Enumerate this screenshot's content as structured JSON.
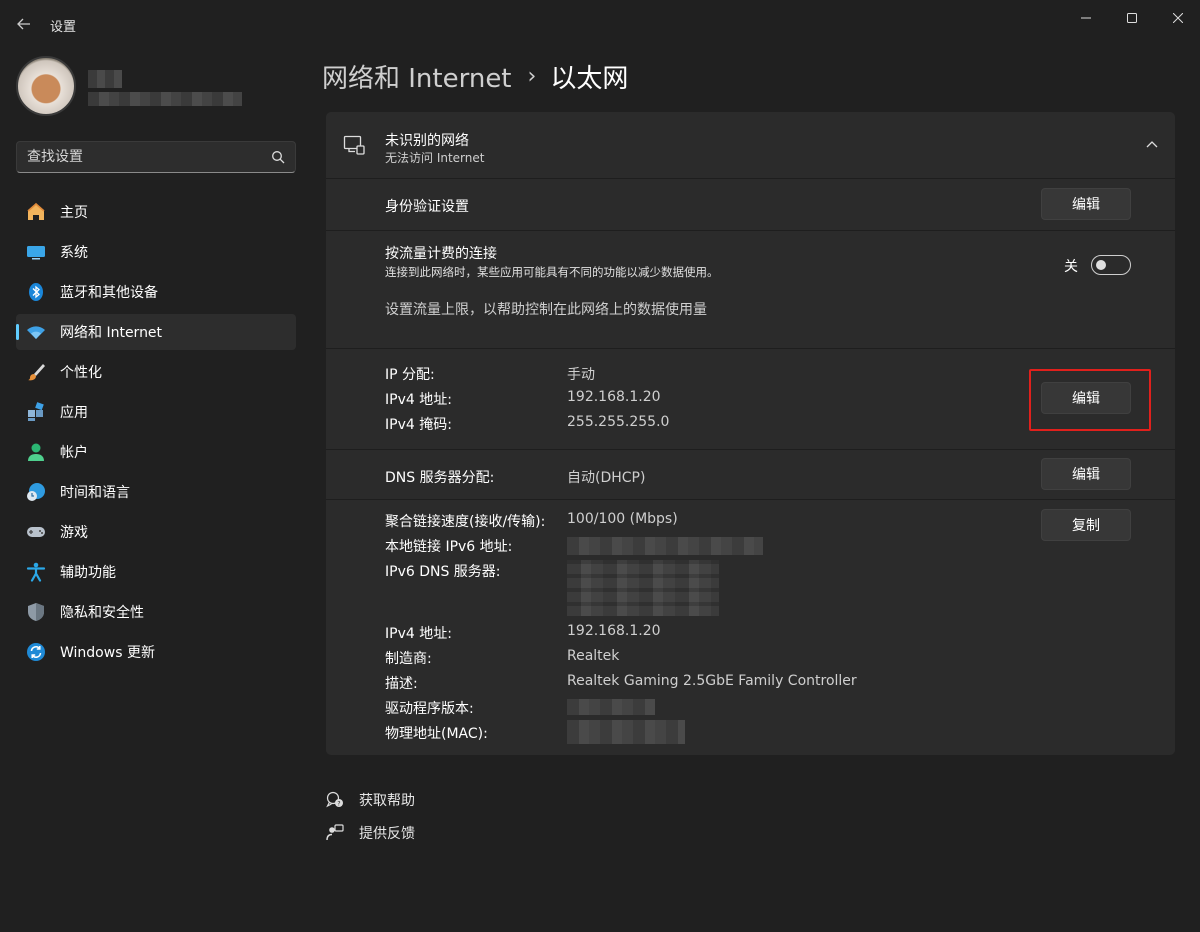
{
  "window": {
    "title": "设置",
    "controls": [
      "minimize-icon",
      "maximize-icon",
      "close-icon"
    ]
  },
  "search": {
    "placeholder": "查找设置"
  },
  "nav": {
    "items": [
      {
        "label": "主页",
        "icon": "home-icon"
      },
      {
        "label": "系统",
        "icon": "system-icon"
      },
      {
        "label": "蓝牙和其他设备",
        "icon": "bluetooth-icon"
      },
      {
        "label": "网络和 Internet",
        "icon": "wifi-icon",
        "active": true
      },
      {
        "label": "个性化",
        "icon": "brush-icon"
      },
      {
        "label": "应用",
        "icon": "apps-icon"
      },
      {
        "label": "帐户",
        "icon": "account-icon"
      },
      {
        "label": "时间和语言",
        "icon": "clock-globe-icon"
      },
      {
        "label": "游戏",
        "icon": "gamepad-icon"
      },
      {
        "label": "辅助功能",
        "icon": "accessibility-icon"
      },
      {
        "label": "隐私和安全性",
        "icon": "shield-icon"
      },
      {
        "label": "Windows 更新",
        "icon": "update-icon"
      }
    ]
  },
  "header": {
    "parent": "网络和 Internet",
    "separator": "›",
    "current": "以太网"
  },
  "network": {
    "name": "未识别的网络",
    "status": "无法访问 Internet",
    "auth_label": "身份验证设置",
    "auth_button": "编辑",
    "metered_title": "按流量计费的连接",
    "metered_desc": "连接到此网络时，某些应用可能具有不同的功能以减少数据使用。",
    "metered_state": "关",
    "metered_on": false,
    "data_limit_link": "设置流量上限，以帮助控制在此网络上的数据使用量",
    "ip": {
      "assignment_label": "IP 分配:",
      "assignment_value": "手动",
      "ipv4_label": "IPv4 地址:",
      "ipv4_value": "192.168.1.20",
      "mask_label": "IPv4 掩码:",
      "mask_value": "255.255.255.0",
      "edit_button": "编辑"
    },
    "dns": {
      "label": "DNS 服务器分配:",
      "value": "自动(DHCP)",
      "edit_button": "编辑"
    },
    "details": {
      "copy_button": "复制",
      "link_speed_label": "聚合链接速度(接收/传输):",
      "link_speed_value": "100/100 (Mbps)",
      "ipv6_local_label": "本地链接 IPv6 地址:",
      "ipv6_dns_label": "IPv6 DNS 服务器:",
      "ipv4_label": "IPv4 地址:",
      "ipv4_value": "192.168.1.20",
      "manufacturer_label": "制造商:",
      "manufacturer_value": "Realtek",
      "description_label": "描述:",
      "description_value": "Realtek Gaming 2.5GbE Family Controller",
      "driver_label": "驱动程序版本:",
      "mac_label": "物理地址(MAC):"
    }
  },
  "footer": {
    "help": "获取帮助",
    "feedback": "提供反馈"
  },
  "colors": {
    "background": "#202020",
    "card": "#2b2b2b",
    "accent": "#60cdff",
    "highlight_box": "#e0201c"
  }
}
